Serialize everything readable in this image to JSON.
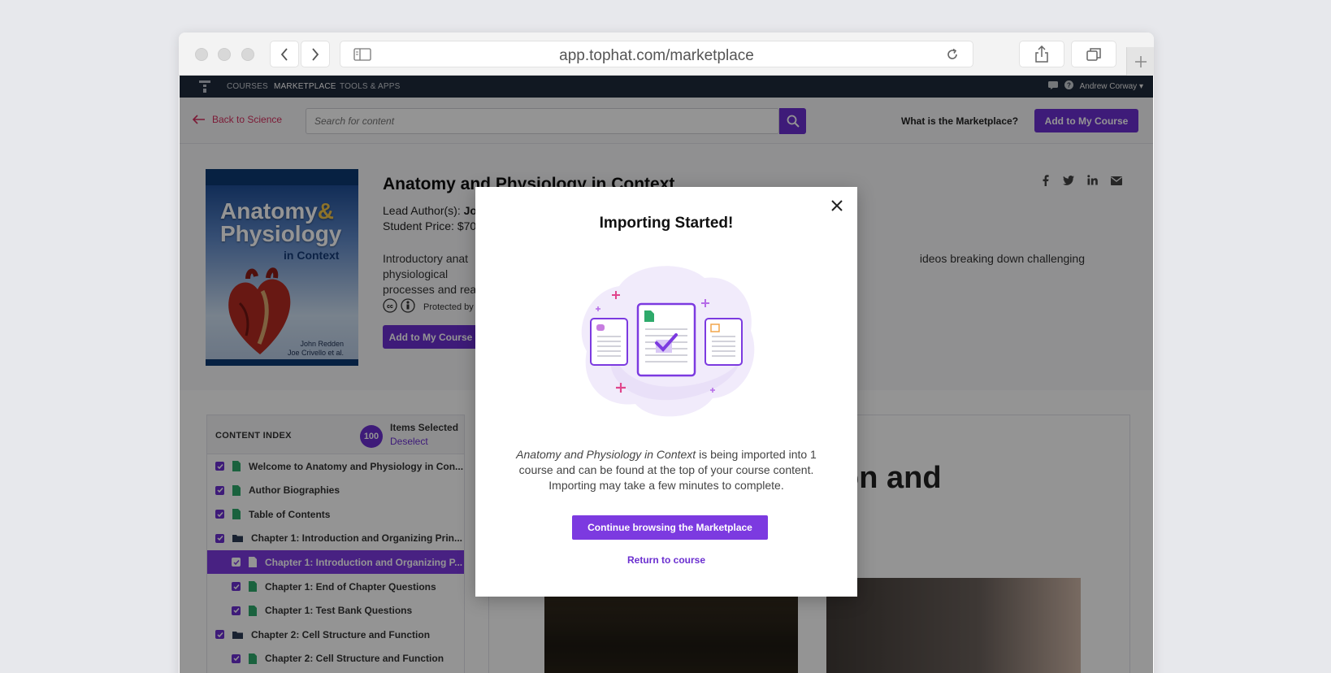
{
  "browser": {
    "url": "app.tophat.com/marketplace"
  },
  "appnav": {
    "links": [
      "COURSES",
      "MARKETPLACE",
      "TOOLS & APPS"
    ],
    "user": "Andrew Corway"
  },
  "subbar": {
    "back": "Back to Science",
    "search_placeholder": "Search for content",
    "what_is": "What is the Marketplace?",
    "add_button": "Add to My Course"
  },
  "book": {
    "cover_title_line1": "Anatomy",
    "cover_amp": "&",
    "cover_title_line2": "Physiology",
    "cover_subtitle": "in Context",
    "cover_author1": "John Redden",
    "cover_author2": "Joe Crivello et al.",
    "title": "Anatomy and Physiology in Context",
    "lead_author_label": "Lead Author(s): ",
    "lead_author_value": "Jo",
    "student_price": "Student Price: $70",
    "description_start": "Introductory anat",
    "description_end": "ideos breaking down challenging physiological",
    "description_line2": "processes and rea",
    "protected": "Protected by",
    "add_button": "Add to My Course"
  },
  "index": {
    "title": "CONTENT INDEX",
    "count": "100",
    "items_selected": "Items Selected",
    "deselect": "Deselect",
    "rows": [
      {
        "label": "Welcome to Anatomy and Physiology in Con...",
        "icon": "page-icon",
        "level": 0
      },
      {
        "label": "Author Biographies",
        "icon": "page-icon",
        "level": 0
      },
      {
        "label": "Table of Contents",
        "icon": "page-icon",
        "level": 0
      },
      {
        "label": "Chapter 1: Introduction and Organizing Prin...",
        "icon": "folder-icon",
        "level": 0
      },
      {
        "label": "Chapter 1: Introduction and Organizing P...",
        "icon": "page-icon",
        "level": 1,
        "selected": true
      },
      {
        "label": "Chapter 1: End of Chapter Questions",
        "icon": "page-icon",
        "level": 1
      },
      {
        "label": "Chapter 1: Test Bank Questions",
        "icon": "page-icon",
        "level": 1
      },
      {
        "label": "Chapter 2: Cell Structure and Function",
        "icon": "folder-icon",
        "level": 0
      },
      {
        "label": "Chapter 2: Cell Structure and Function",
        "icon": "page-icon",
        "level": 1
      }
    ]
  },
  "reader": {
    "heading_fragment": "on and"
  },
  "modal": {
    "title": "Importing Started!",
    "body_italic": "Anatomy and Physiology in Context",
    "body_rest": " is being imported into 1 course and can be found at the top of your course content. Importing may take a few minutes to complete.",
    "continue_button": "Continue browsing the Marketplace",
    "return_link": "Return to course"
  },
  "colors": {
    "accent": "#6b2fd0",
    "navbar": "#1e2a3c",
    "back_link": "#d6305f"
  }
}
